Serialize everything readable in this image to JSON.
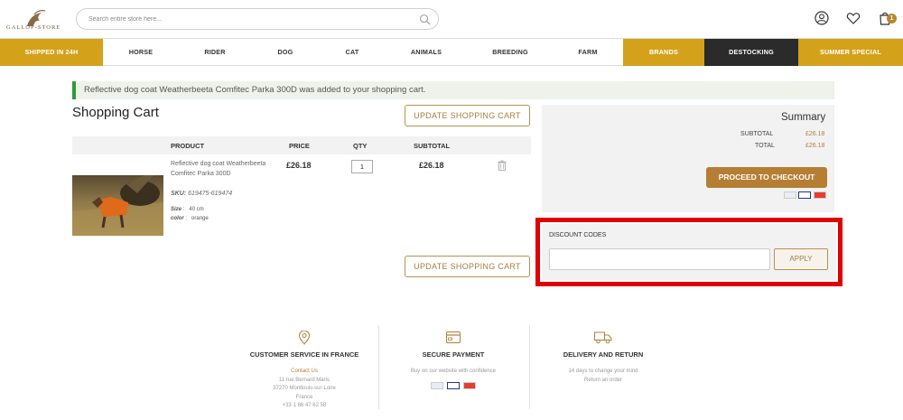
{
  "header": {
    "logo_text": "GALLOP-STORE",
    "search_placeholder": "Search entire store here...",
    "cart_count": "1"
  },
  "nav": {
    "items": [
      "SHIPPED IN 24H",
      "HORSE",
      "RIDER",
      "DOG",
      "CAT",
      "ANIMALS",
      "BREEDING",
      "FARM",
      "BRANDS",
      "DESTOCKING",
      "SUMMER SPECIAL"
    ]
  },
  "message": "Reflective dog coat Weatherbeeta Comfitec Parka 300D was added to your shopping cart.",
  "cart": {
    "title": "Shopping Cart",
    "update_label": "UPDATE SHOPPING CART",
    "columns": [
      "PRODUCT",
      "PRICE",
      "QTY",
      "SUBTOTAL"
    ],
    "item": {
      "name": "Reflective dog coat Weatherbeeta Comfitec Parka 300D",
      "sku_label": "SKU:",
      "sku": "619475-619474",
      "size_label": "Size",
      "size": "40 cm",
      "color_label": "color",
      "color": "orange",
      "price": "£26.18",
      "qty": "1",
      "subtotal": "£26.18"
    }
  },
  "summary": {
    "title": "Summary",
    "subtotal_label": "SUBTOTAL",
    "subtotal": "£26.18",
    "total_label": "TOTAL",
    "total": "£26.18",
    "checkout_label": "PROCEED TO CHECKOUT"
  },
  "discount": {
    "label": "DISCOUNT CODES",
    "input_value": "",
    "apply_label": "APPLY"
  },
  "footer": {
    "service": {
      "title": "CUSTOMER SERVICE IN FRANCE",
      "lines": [
        "Contact Us",
        "11 rue Bernard Maris",
        "37270 Montlouis-sur-Loire",
        "France",
        "+33 1 86 47 62 58"
      ]
    },
    "payment": {
      "title": "SECURE PAYMENT",
      "line": "Buy on our website with confidence"
    },
    "delivery": {
      "title": "DELIVERY AND RETURN",
      "lines": [
        "14 days to change your mind",
        "Return an order"
      ]
    }
  },
  "colors": {
    "gold": "#d3a21a",
    "accent": "#b57e33",
    "highlight": "#e00000",
    "dark": "#2b2b2b"
  }
}
